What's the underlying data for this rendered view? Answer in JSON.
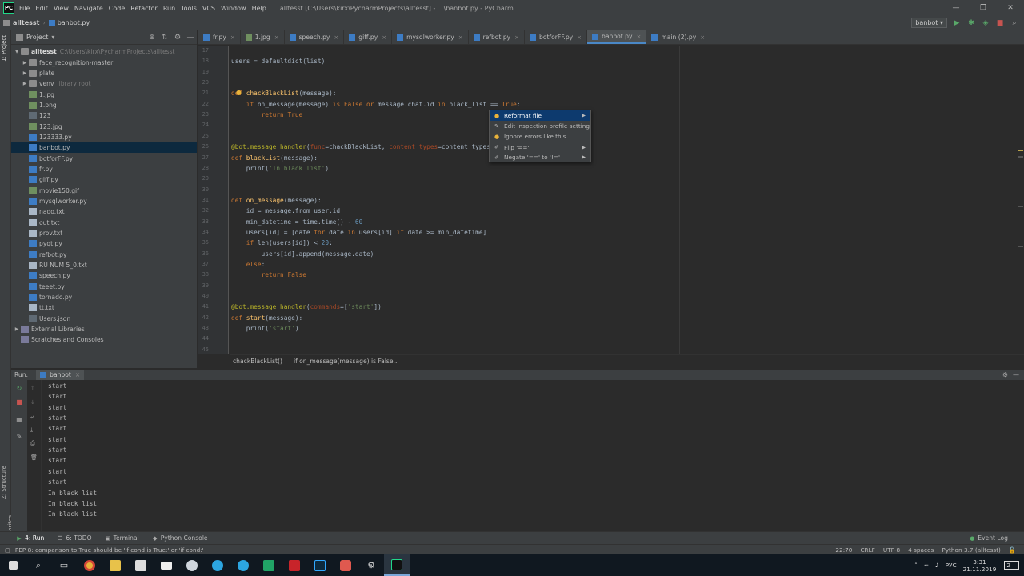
{
  "titlebar": {
    "menus": [
      "File",
      "Edit",
      "View",
      "Navigate",
      "Code",
      "Refactor",
      "Run",
      "Tools",
      "VCS",
      "Window",
      "Help"
    ],
    "window_title": "alltesst [C:\\Users\\kirx\\PycharmProjects\\alltesst] - ...\\banbot.py - PyCharm",
    "logo": "PC"
  },
  "navbar": {
    "project": "alltesst",
    "file": "banbot.py",
    "run_config": "banbot"
  },
  "left_tool": {
    "project_label": "1: Project",
    "structure_label": "Z: Structure",
    "favorites_label": "2: Favorites"
  },
  "project_panel": {
    "title": "Project",
    "root": {
      "name": "alltesst",
      "path": "C:\\Users\\kirx\\PycharmProjects\\alltesst"
    },
    "items": [
      {
        "name": "face_recognition-master",
        "type": "folder",
        "arrow": true
      },
      {
        "name": "plate",
        "type": "folder",
        "arrow": true
      },
      {
        "name": "venv",
        "type": "folder",
        "arrow": true,
        "hint": "library root"
      },
      {
        "name": "1.jpg",
        "type": "img"
      },
      {
        "name": "1.png",
        "type": "img"
      },
      {
        "name": "123",
        "type": "file"
      },
      {
        "name": "123.jpg",
        "type": "img"
      },
      {
        "name": "123333.py",
        "type": "py"
      },
      {
        "name": "banbot.py",
        "type": "py",
        "selected": true
      },
      {
        "name": "botforFF.py",
        "type": "py"
      },
      {
        "name": "fr.py",
        "type": "py"
      },
      {
        "name": "giff.py",
        "type": "py"
      },
      {
        "name": "movie150.gif",
        "type": "img"
      },
      {
        "name": "mysqlworker.py",
        "type": "py"
      },
      {
        "name": "nado.txt",
        "type": "txt"
      },
      {
        "name": "out.txt",
        "type": "txt"
      },
      {
        "name": "prov.txt",
        "type": "txt"
      },
      {
        "name": "pyqt.py",
        "type": "py"
      },
      {
        "name": "refbot.py",
        "type": "py"
      },
      {
        "name": "RU NUM 5_0.txt",
        "type": "txt"
      },
      {
        "name": "speech.py",
        "type": "py"
      },
      {
        "name": "teeet.py",
        "type": "py"
      },
      {
        "name": "tornado.py",
        "type": "py"
      },
      {
        "name": "tt.txt",
        "type": "txt"
      },
      {
        "name": "Users.json",
        "type": "file"
      }
    ],
    "external": "External Libraries",
    "scratches": "Scratches and Consoles"
  },
  "tabs": [
    {
      "name": "fr.py",
      "kind": "py"
    },
    {
      "name": "1.jpg",
      "kind": "img"
    },
    {
      "name": "speech.py",
      "kind": "py"
    },
    {
      "name": "giff.py",
      "kind": "py"
    },
    {
      "name": "mysqlworker.py",
      "kind": "py"
    },
    {
      "name": "refbot.py",
      "kind": "py"
    },
    {
      "name": "botforFF.py",
      "kind": "py"
    },
    {
      "name": "banbot.py",
      "kind": "py",
      "active": true
    },
    {
      "name": "main (2).py",
      "kind": "py"
    }
  ],
  "line_numbers": [
    "17",
    "18",
    "19",
    "20",
    "21",
    "22",
    "23",
    "24",
    "25",
    "26",
    "27",
    "28",
    "29",
    "30",
    "31",
    "32",
    "33",
    "34",
    "35",
    "36",
    "37",
    "38",
    "39",
    "40",
    "41",
    "42",
    "43",
    "44",
    "45"
  ],
  "code_lines": [
    "",
    "users = defaultdict(list)",
    "",
    "",
    "def chackBlackList(message):",
    "    if on_message(message) is False or message.chat.id in black_list == True:",
    "        return True",
    "",
    "",
    "@bot.message_handler(func=chackBlackList, content_types=content_types)",
    "def blackList(message):",
    "    print('In black list')",
    "",
    "",
    "def on_message(message):",
    "    id = message.from_user.id",
    "    min_datetime = time.time() - 60",
    "    users[id] = [date for date in users[id] if date >= min_datetime]",
    "    if len(users[id]) < 20:",
    "        users[id].append(message.date)",
    "    else:",
    "        return False",
    "",
    "",
    "@bot.message_handler(commands=['start'])",
    "def start(message):",
    "    print('start')",
    "",
    ""
  ],
  "breadcrumb": [
    "chackBlackList()",
    "if on_message(message) is False..."
  ],
  "popup": {
    "items": [
      {
        "label": "Reformat file",
        "icon": "bulb",
        "submenu": true,
        "selected": true
      },
      {
        "label": "Edit inspection profile setting",
        "icon": "wrench",
        "submenu": false
      },
      {
        "label": "Ignore errors like this",
        "icon": "bulb",
        "submenu": false
      },
      {
        "label": "Flip '=='",
        "icon": "pencil",
        "submenu": true,
        "sep": true
      },
      {
        "label": "Negate '==' to '!='",
        "icon": "pencil",
        "submenu": true
      }
    ]
  },
  "run_panel": {
    "label": "Run:",
    "tab": "banbot",
    "output": [
      "start",
      "start",
      "start",
      "start",
      "start",
      "start",
      "start",
      "start",
      "start",
      "start",
      "In black list",
      "In black list",
      "In black list"
    ]
  },
  "bottom_tabs": [
    {
      "label": "4: Run",
      "icon": "play",
      "active": true
    },
    {
      "label": "6: TODO",
      "icon": "list"
    },
    {
      "label": "Terminal",
      "icon": "term"
    },
    {
      "label": "Python Console",
      "icon": "py"
    }
  ],
  "event_log": "Event Log",
  "statusbar": {
    "message": "PEP 8: comparison to True should be 'if cond is True:' or 'if cond:'",
    "position": "22:70",
    "line_sep": "CRLF",
    "encoding": "UTF-8",
    "indent": "4 spaces",
    "interpreter": "Python 3.7 (alltesst)"
  },
  "taskbar": {
    "lang": "РУС",
    "time": "3:31",
    "date": "21.11.2019",
    "notif_count": "2"
  }
}
